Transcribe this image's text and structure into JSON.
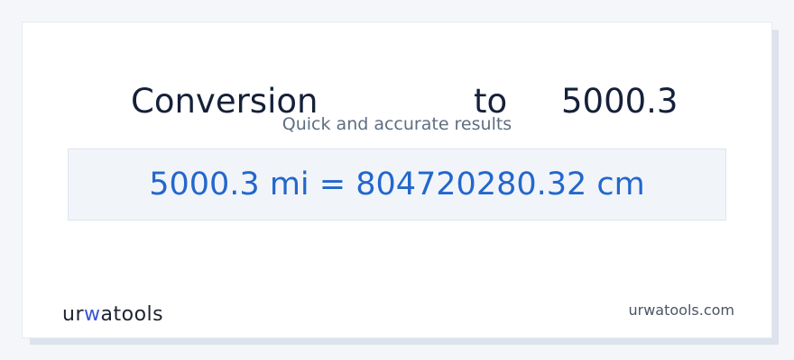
{
  "header": {
    "title_word": "Conversion",
    "title_to": "to",
    "title_value": "5000.3",
    "subtitle": "Quick and accurate results"
  },
  "result": {
    "text": "5000.3 mi = 804720280.32 cm"
  },
  "brand": {
    "logo_text": "urwatools",
    "logo_part1": "ur",
    "logo_part2": "w",
    "logo_part3": "atools",
    "domain": "urwatools.com",
    "accent": "#3556d8"
  }
}
